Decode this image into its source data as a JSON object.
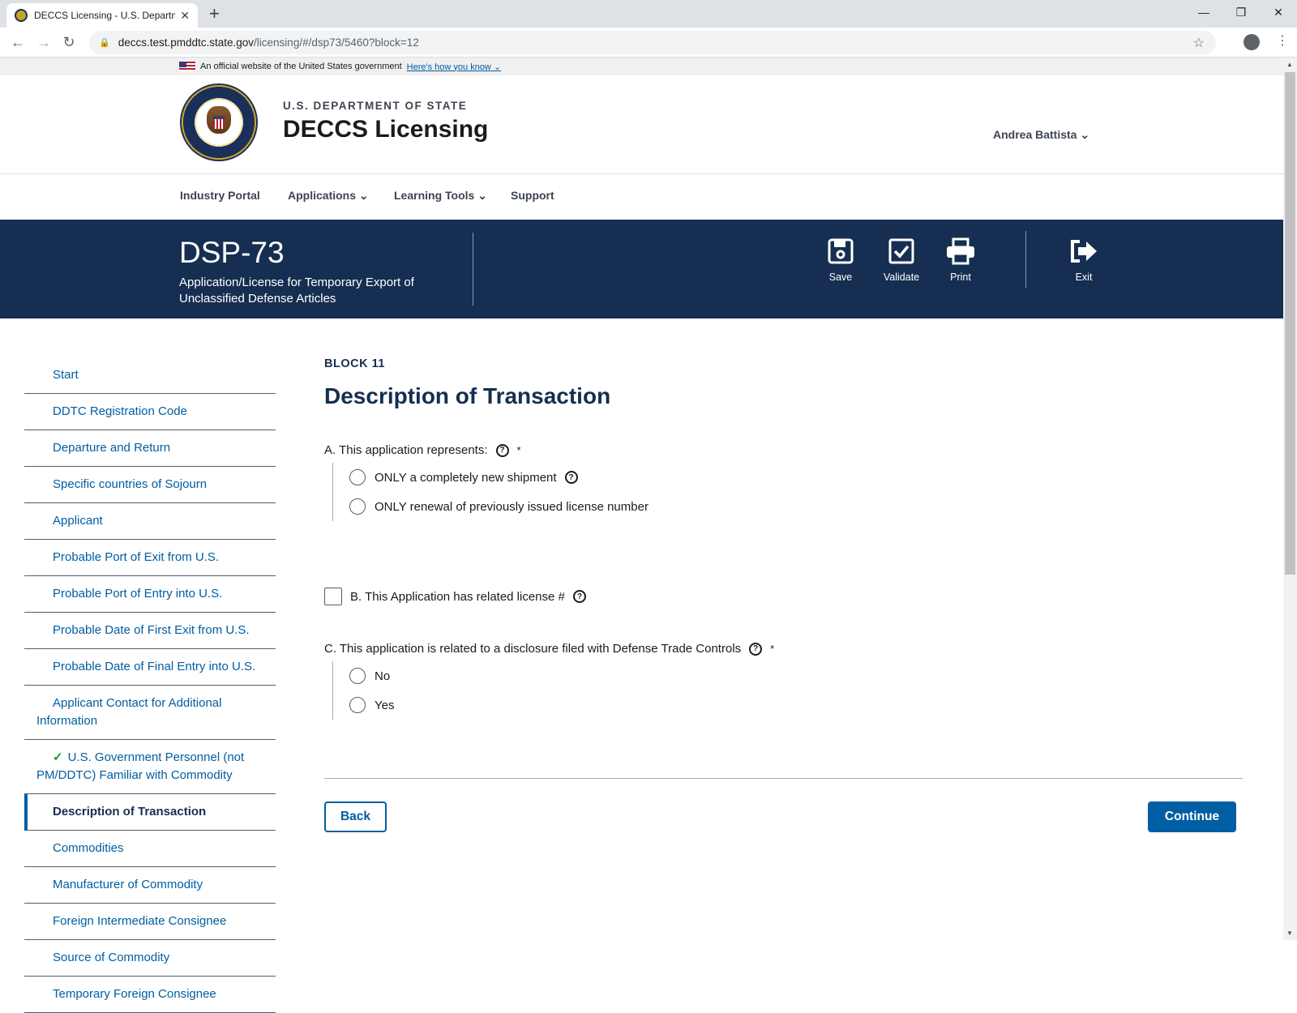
{
  "browser": {
    "tab_title": "DECCS Licensing - U.S. Departme",
    "url_host": "deccs.test.pmddtc.state.gov",
    "url_path": "/licensing/#/dsp73/5460?block=12"
  },
  "gov_banner": {
    "text": "An official website of the United States government",
    "link": "Here's how you know"
  },
  "header": {
    "department": "U.S. DEPARTMENT OF STATE",
    "app_title": "DECCS Licensing",
    "user": "Andrea Battista"
  },
  "nav": {
    "items": [
      "Industry Portal",
      "Applications",
      "Learning Tools",
      "Support"
    ]
  },
  "hero": {
    "form_code": "DSP-73",
    "form_description": "Application/License for Temporary Export of Unclassified Defense Articles",
    "actions": {
      "save": "Save",
      "validate": "Validate",
      "print": "Print",
      "exit": "Exit"
    }
  },
  "sidebar": {
    "items": [
      "Start",
      "DDTC Registration Code",
      "Departure and Return",
      "Specific countries of Sojourn",
      "Applicant",
      "Probable Port of Exit from U.S.",
      "Probable Port of Entry into U.S.",
      "Probable Date of First Exit from U.S.",
      "Probable Date of Final Entry into U.S.",
      "Applicant Contact for Additional Information",
      "U.S. Government Personnel (not PM/DDTC) Familiar with Commodity",
      "Description of Transaction",
      "Commodities",
      "Manufacturer of Commodity",
      "Foreign Intermediate Consignee",
      "Source of Commodity",
      "Temporary Foreign Consignee"
    ],
    "completed_index": 10,
    "current_index": 11
  },
  "main": {
    "block_label": "BLOCK 11",
    "title": "Description of Transaction",
    "question_a": {
      "label": "A. This application represents:",
      "required": "*",
      "options": [
        "ONLY a completely new shipment",
        "ONLY renewal of previously issued license number"
      ]
    },
    "question_b": {
      "label": "B. This Application has related license #",
      "checked": false
    },
    "question_c": {
      "label": "C. This application is related to a disclosure filed with Defense Trade Controls",
      "required": "*",
      "options": [
        "No",
        "Yes"
      ]
    },
    "back_label": "Back",
    "continue_label": "Continue"
  },
  "colors": {
    "hero_bg": "#162e51",
    "link": "#005ea2",
    "primary_button": "#005ea2",
    "check": "#00a91c"
  }
}
